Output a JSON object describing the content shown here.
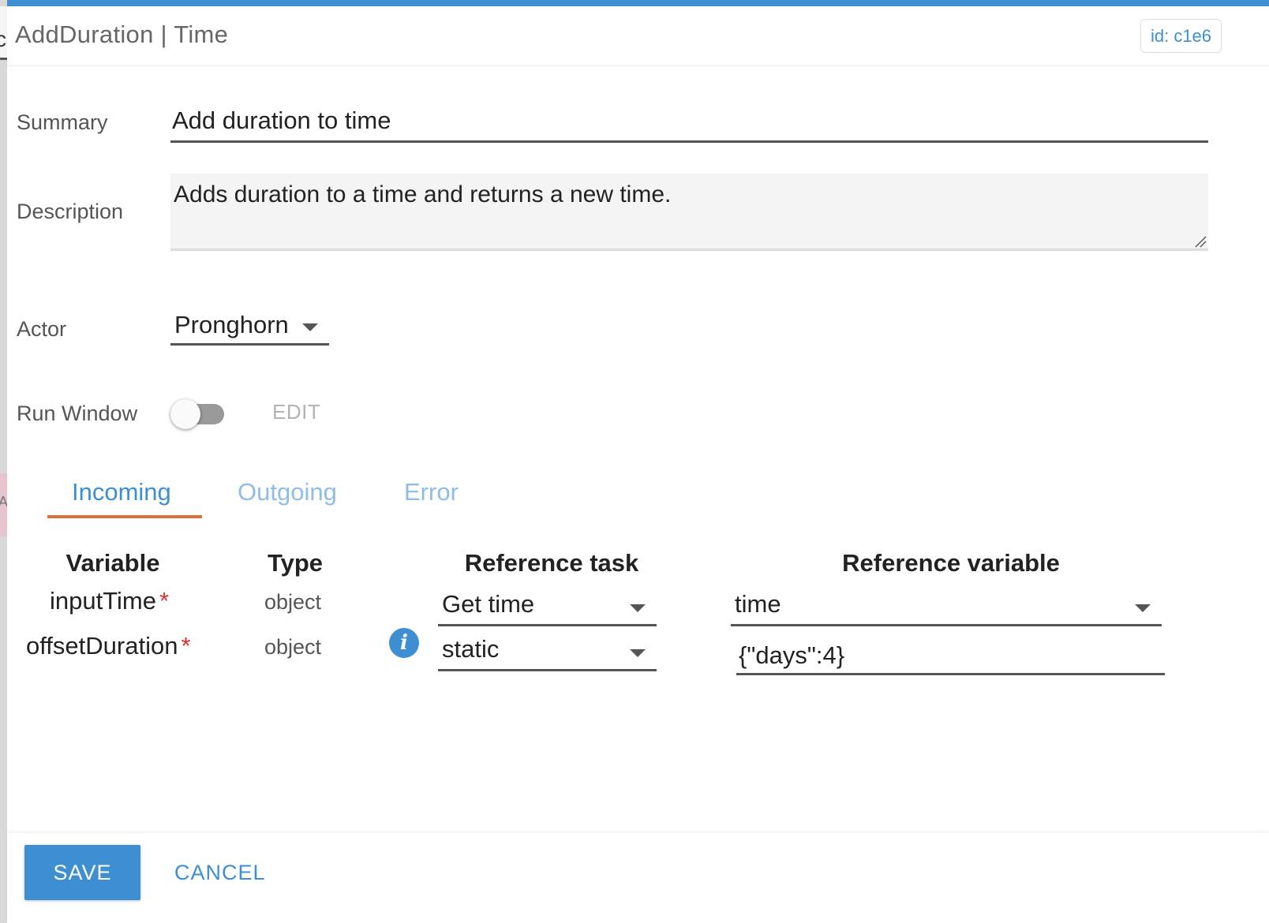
{
  "dialog": {
    "title": "AddDuration | Time",
    "id_badge": "id: c1e6"
  },
  "form": {
    "summary_label": "Summary",
    "summary_value": "Add duration to time",
    "description_label": "Description",
    "description_value": "Adds duration to a time and returns a new time.",
    "actor_label": "Actor",
    "actor_value": "Pronghorn",
    "run_window_label": "Run Window",
    "run_window_enabled": false,
    "edit_label": "EDIT"
  },
  "tabs": [
    {
      "label": "Incoming",
      "active": true
    },
    {
      "label": "Outgoing",
      "active": false
    },
    {
      "label": "Error",
      "active": false
    }
  ],
  "table": {
    "headers": [
      "Variable",
      "Type",
      "Reference task",
      "Reference variable"
    ],
    "rows": [
      {
        "variable": "inputTime",
        "required_mark": "*",
        "type": "object",
        "reference_task": "Get time",
        "reference_variable": "time"
      },
      {
        "variable": "offsetDuration",
        "required_mark": "*",
        "type": "object",
        "info_icon": "i",
        "reference_task": "static",
        "reference_variable": "{\"days\":4}"
      }
    ]
  },
  "footer": {
    "save_label": "SAVE",
    "cancel_label": "CANCEL"
  },
  "colors": {
    "accent": "#3d8fd2",
    "tab_underline": "#e0703a",
    "required": "#e03131"
  },
  "icons": [
    "info-icon",
    "chevron-down-icon",
    "resize-grip-icon"
  ]
}
